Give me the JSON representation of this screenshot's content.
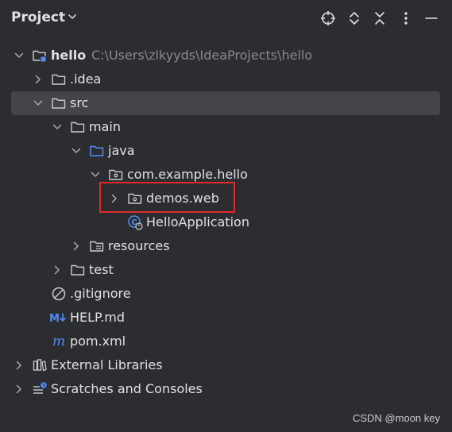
{
  "header": {
    "title": "Project",
    "icons": [
      "crosshair-icon",
      "expand-icon",
      "collapse-icon",
      "more-options-icon",
      "minimize-icon"
    ]
  },
  "tree": {
    "project_name": "hello",
    "project_path": "C:\\Users\\zlkyyds\\IdeaProjects\\hello",
    "idea": ".idea",
    "src": "src",
    "main": "main",
    "java": "java",
    "package": "com.example.hello",
    "demos": "demos.web",
    "app": "HelloApplication",
    "resources": "resources",
    "test": "test",
    "gitignore": ".gitignore",
    "help": "HELP.md",
    "pom": "pom.xml",
    "external_libraries": "External Libraries",
    "scratches": "Scratches and Consoles"
  },
  "colors": {
    "background": "#2b2d30",
    "selection": "#43454a",
    "folder_blue": "#548af7",
    "highlight_red": "#e02a2a",
    "text": "#dfe1e5",
    "muted": "#868a91"
  },
  "watermark": "CSDN @moon key"
}
